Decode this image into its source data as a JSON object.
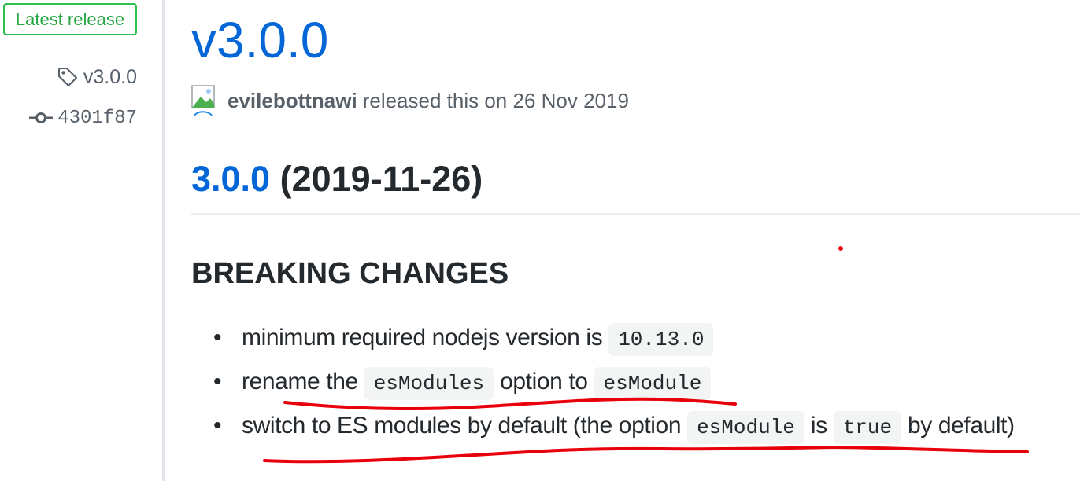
{
  "sidebar": {
    "badge": "Latest release",
    "tag": "v3.0.0",
    "commit": "4301f87"
  },
  "release": {
    "title": "v3.0.0",
    "author": "evilebottnawi",
    "released_text": "released this on 26 Nov 2019"
  },
  "notes": {
    "version_link": "3.0.0",
    "version_date": "(2019-11-26)",
    "section_title": "BREAKING CHANGES",
    "items": [
      {
        "text_before": "minimum required nodejs version is",
        "code1": "10.13.0"
      },
      {
        "text_before": "rename the",
        "code1": "esModules",
        "text_middle": "option to",
        "code2": "esModule"
      },
      {
        "text_before": "switch to ES modules by default (the option",
        "code1": "esModule",
        "text_middle": "is",
        "code2": "true",
        "text_after": "by default)"
      }
    ]
  },
  "colors": {
    "link": "#0366d6",
    "badge_green": "#28a745",
    "annotation_red": "#e8000b"
  },
  "icons": [
    "tag-icon",
    "commit-icon",
    "broken-avatar-icon"
  ]
}
